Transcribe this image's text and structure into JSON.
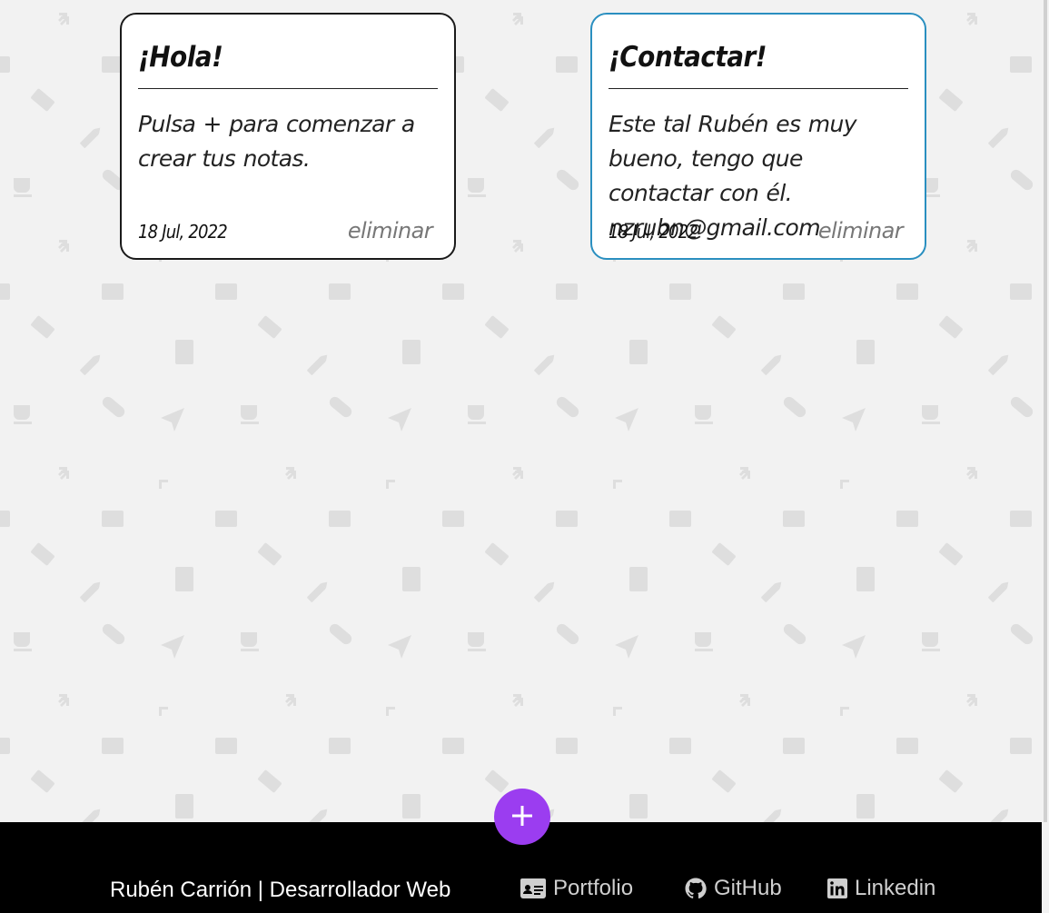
{
  "notes": [
    {
      "title": "¡Hola!",
      "body": "Pulsa + para comenzar a crear tus notas.",
      "date": "18 Jul, 2022",
      "delete_label": "eliminar",
      "border_color": "#1a1a1a"
    },
    {
      "title": "¡Contactar!",
      "body": "Este tal Rubén es muy bueno, tengo que contactar con él. nzrubn@gmail.com",
      "date": "18 Jul, 2022",
      "delete_label": "eliminar",
      "border_color": "#2a8fc0"
    }
  ],
  "add_button": {
    "icon": "plus-icon",
    "color": "#9b3df0"
  },
  "footer": {
    "author": "Rubén Carrión | Desarrollador Web",
    "links": [
      {
        "label": "Portfolio",
        "icon": "id-card-icon"
      },
      {
        "label": "GitHub",
        "icon": "github-icon"
      },
      {
        "label": "Linkedin",
        "icon": "linkedin-icon"
      }
    ]
  },
  "colors": {
    "background": "#f2f2f2",
    "footer": "#000000",
    "accent": "#9b3df0"
  }
}
